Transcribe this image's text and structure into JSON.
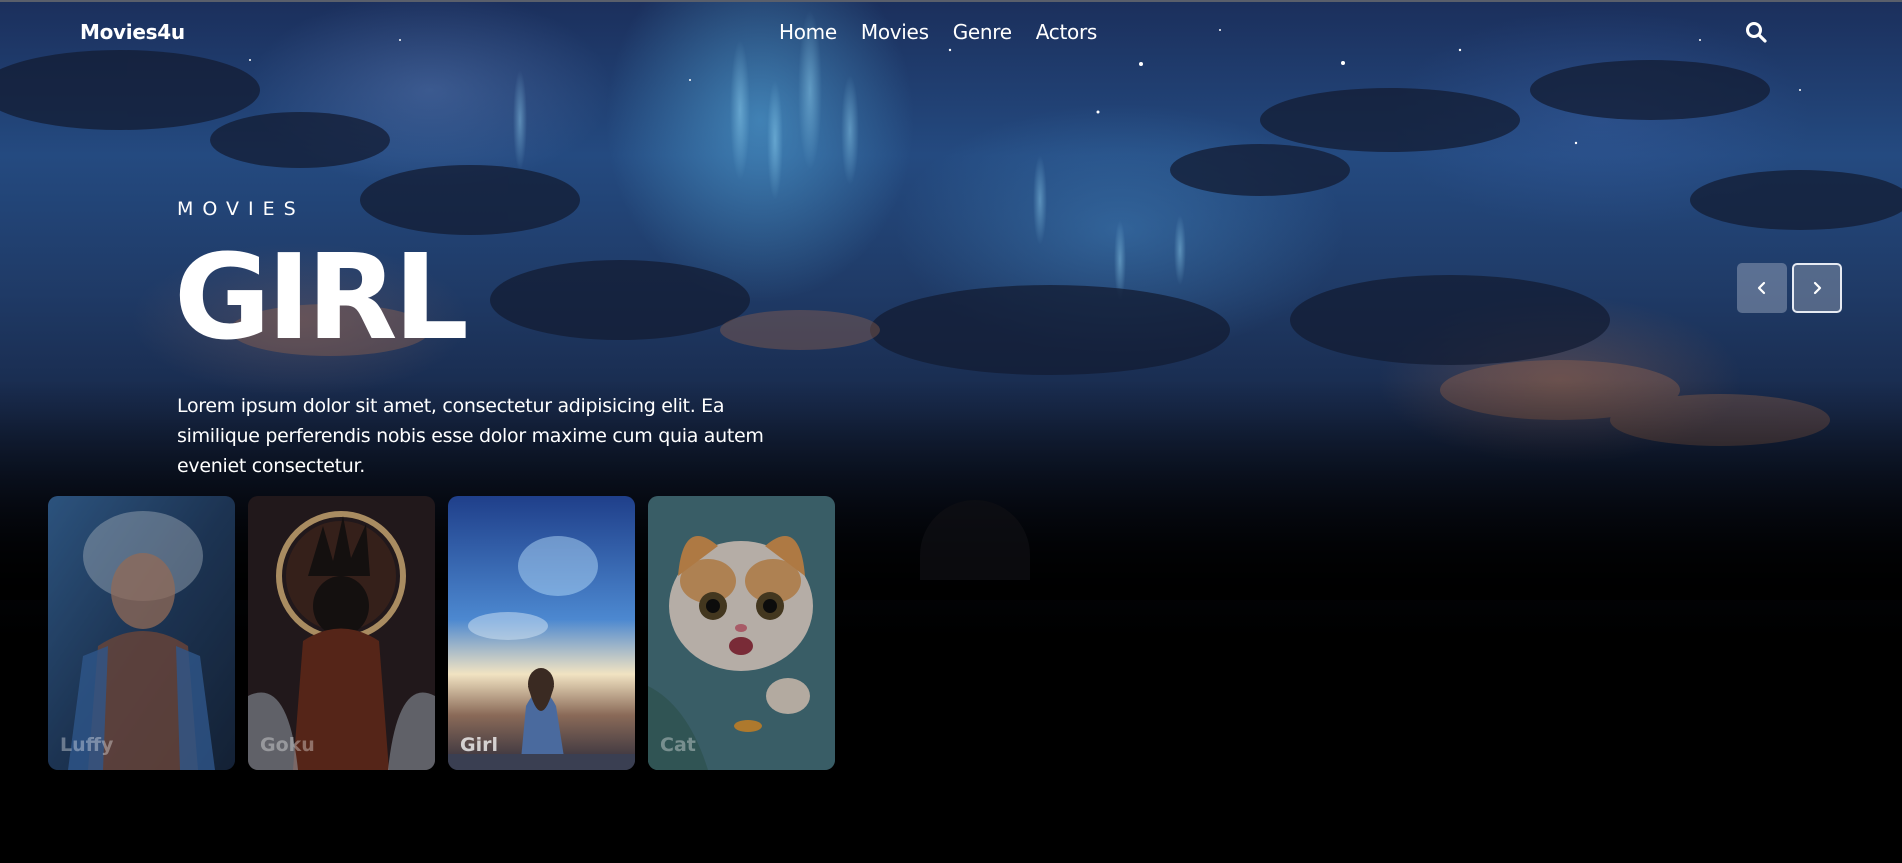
{
  "header": {
    "logo": "Movies4u",
    "nav": [
      {
        "label": "Home"
      },
      {
        "label": "Movies"
      },
      {
        "label": "Genre"
      },
      {
        "label": "Actors"
      }
    ],
    "search_icon": "search-icon"
  },
  "hero": {
    "kicker": "MOVIES",
    "title": "GIRL",
    "description": "Lorem ipsum dolor sit amet, consectetur adipisicing elit. Ea similique perferendis nobis esse dolor maxime cum quia autem eveniet consectetur."
  },
  "slider": {
    "prev_icon": "chevron-left-icon",
    "next_icon": "chevron-right-icon"
  },
  "cards": [
    {
      "label": "Luffy"
    },
    {
      "label": "Goku"
    },
    {
      "label": "Girl"
    },
    {
      "label": "Cat"
    }
  ],
  "colors": {
    "background": "#000000",
    "sky_top": "#1b2f5c",
    "text": "#ffffff",
    "arrow_bg": "#8c9bb4"
  }
}
